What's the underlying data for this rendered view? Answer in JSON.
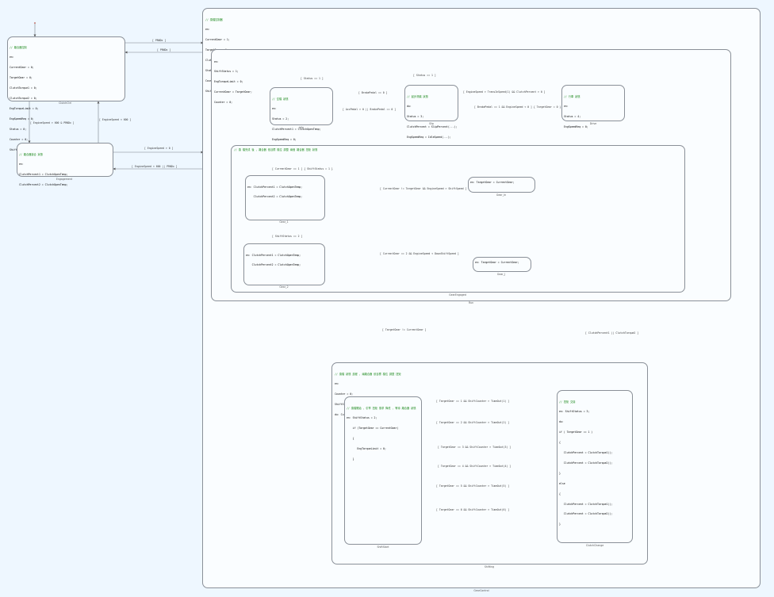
{
  "colors": {
    "comment": "#1e8a1e",
    "keyword": "#2222cc",
    "number": "#d08000",
    "border": "#8a9098",
    "background": "#eef7ff"
  },
  "states": {
    "gear_control": {
      "label": "GearControl",
      "lines": [
        "// 換檔控制器 ",
        "en:",
        "CurrentGear = 1;",
        "TargetGear = 1;",
        "ClutchPercent = ClutchOpenTemp;",
        "Status = 0;",
        "Counter = 0;",
        "ShiftStatus = 0;"
      ]
    },
    "clutch_ctrl": {
      "label": "ClutchCtrl",
      "lines": [
        "// 離合器控制",
        "en:",
        "CurrentGear = 0;",
        "TargetGear = 0;",
        "ClutchTorque1 = 0;",
        "ClutchTorque2 = 0;",
        "EngTorqueLimit = 0;",
        "EngSpeedReq = 0;",
        "Status = 0;",
        "Counter = 0;",
        "ShiftStatus = 0;"
      ]
    },
    "engagement": {
      "label": "Engagement",
      "lines": [
        "// 離合器接合 狀態",
        "en:",
        "ClutchPercent1 = ClutchOpenTemp;",
        "ClutchPercent2 = ClutchOpenTemp;"
      ]
    },
    "run": {
      "label": "Run",
      "lines": [
        "en:",
        "ShiftStatus = 1;",
        "EngTorqueLimit = 0;",
        "CurrentGear = TargetGear;",
        "Counter = 0;"
      ]
    },
    "idle": {
      "label": "Idle",
      "lines": [
        "// 空檔 狀態",
        "en:",
        "Status = 2;",
        "ClutchPercent1 = ClutchOpenTemp;",
        "EngSpeedReq = 0;"
      ]
    },
    "slip": {
      "label": "Slip",
      "lines": [
        "// 起步滑磨 狀態",
        "du:",
        "Status = 3;",
        "ClutchPercent = SlipPercent(...);",
        "EngSpeedReq = IdleSpeed(...);"
      ]
    },
    "drive": {
      "label": "Drive",
      "lines": [
        "// 行車 狀態",
        "en:",
        "Status = 4;",
        "EngSpeedReq = 0;"
      ]
    },
    "gear_engaged": {
      "label": "GearEngaged",
      "title": "// 換 檔完成 後 , 離合器 依目標 檔位 調整 兩個 離合器 扭矩 狀態",
      "gear_1": {
        "label": "Gear_1",
        "lines": [
          "en: ClutchPercent1 = ClutchOpenTemp;",
          "    ClutchPercent2 = ClutchOpenTemp;"
        ]
      },
      "gear_2": {
        "label": "Gear_2",
        "lines": [
          "en: ClutchPercent1 = ClutchOpenTemp;",
          "    ClutchPercent2 = ClutchOpenTemp;"
        ]
      },
      "gear_in": {
        "label": "Gear_In",
        "lines": [
          "en: TargetGear = CurrentGear;"
        ]
      },
      "gear_j": {
        "label": "Gear_J",
        "lines": [
          "en: TargetGear = CurrentGear;"
        ]
      }
    },
    "shifting": {
      "label": "Shifting",
      "lines": [
        "// 換檔 狀態 過程 , 兩離合器 依目標 檔位 調整 扭矩",
        "en:",
        "Counter = 0;",
        "ShiftStatus = 2;",
        "du: CurrentGear = 0;"
      ]
    },
    "shift_start": {
      "label": "ShiftStart",
      "lines": [
        "// 換檔開始 , 引擎 扭矩 需求 降低 , 等待 離合器 狀態",
        "en: ShiftStatus = 2;",
        "    if (TargetGear == CurrentGear)",
        "    {",
        "       EngTorqueLimit = 0;",
        "    }"
      ]
    },
    "clutch_change": {
      "label": "ClutchChange",
      "lines": [
        "// 扭矩 交接",
        "en: ShiftStatus = 3;",
        "du:",
        "if ( TargetGear == 1 )",
        "{",
        "   ClutchPercent = ClutchTorque1();",
        "   ClutchPercent = ClutchTorque2();",
        "}",
        "else",
        "{",
        "   ClutchPercent = ClutchTorque1();",
        "   ClutchPercent = ClutchTorque2();",
        "}"
      ]
    }
  },
  "transitions": {
    "t_prnd_1": "[ PRNDx ]",
    "t_prnd_2": "[ PRNDx ]",
    "t_engine_speed_1": "[ EngineSpeed > 600 & PRNDx ]",
    "t_engine_speed_2": "[ EngineSpeed < 600 ]",
    "t_engaged": "[ EngineSpeed > 0 ]",
    "t_engine_speed_3": "[ EngineSpeed < 600 || PRNDx ]",
    "t_status": "[ Status == 1 ]",
    "t_brake_off": "[ BrakePedal == 0 ]",
    "t_accel": "[ AccPedal > 0 || BrakePedal == 0 ]",
    "t_to_drive": "[ EngineSpeed > TransInSpeed(1) && ClutchPercent > 0 ]",
    "t_from_drive": "[ BrakePedal == 1 && EngineSpeed < 0 ] { TargetGear = 0 }",
    "t_status_2": "[ Status == 1 ]",
    "t_gear_1": "[ CurrentGear == 1 ] { ShiftStatus = 1 }",
    "t_gear_2": "[ ShiftStatus == 2 ]",
    "t_gear_in_cond": "[ CurrentGear != TargetGear && EngineSpeed > ShiftSpeed ]",
    "t_gear_j_cond": "[ CurrentGear == 2 && EngineSpeed < DownShiftSpeed ]",
    "t_to_shifting": "[ TargetGear != CurrentGear ]",
    "t_from_shifting": "[ ClutchPercent1 || ClutchTorque2 ]",
    "t_shift_1": "[ TargetGear == 1 && ShiftCounter > TimeOut(1) ]",
    "t_shift_2": "[ TargetGear == 2 && ShiftCounter > TimeOut(2) ]",
    "t_shift_3": "[ TargetGear == 3 && ShiftCounter > TimeOut(3) ]",
    "t_shift_4": "[ TargetGear == 4 && ShiftCounter > TimeOut(4) ]",
    "t_shift_5": "[ TargetGear == 5 && ShiftCounter > TimeOut(5) ]",
    "t_shift_6": "[ TargetGear == 6 && ShiftCounter > TimeOut(6) ]"
  }
}
